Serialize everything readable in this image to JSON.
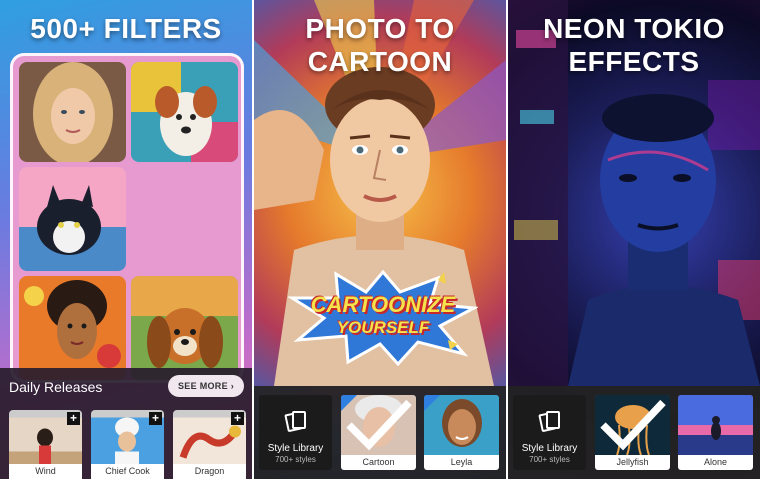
{
  "panels": {
    "filters": {
      "headline": "500+ FILTERS",
      "daily_releases": {
        "title": "Daily Releases",
        "see_more": "SEE MORE ›",
        "items": [
          {
            "label": "Wind"
          },
          {
            "label": "Chief Cook"
          },
          {
            "label": "Dragon"
          }
        ]
      }
    },
    "cartoon": {
      "headline_line1": "PHOTO TO",
      "headline_line2": "CARTOON",
      "sticker_line1": "CARTOONIZE",
      "sticker_line2": "YOURSELF",
      "style_library": {
        "title": "Style Library",
        "subtitle": "700+ styles"
      },
      "styles": [
        {
          "label": "Cartoon",
          "selected": true
        },
        {
          "label": "Leyla",
          "selected": false
        }
      ]
    },
    "neon": {
      "headline_line1": "NEON TOKIO",
      "headline_line2": "EFFECTS",
      "style_library": {
        "title": "Style Library",
        "subtitle": "700+ styles"
      },
      "styles": [
        {
          "label": "Jellyfish",
          "selected": true
        },
        {
          "label": "Alone",
          "selected": false
        }
      ]
    }
  },
  "icons": {
    "plus": "+",
    "style_library": "photo-stack-icon",
    "check": "checkmark-icon"
  },
  "colors": {
    "accent": "#2f7fe0",
    "bar_dark": "#232323",
    "grid_pink": "#e79ad0"
  }
}
